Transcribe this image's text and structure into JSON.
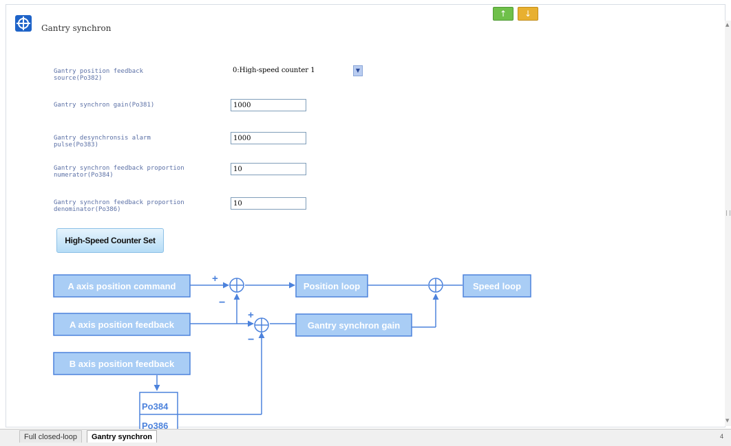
{
  "window": {
    "title": "Gantry synchron"
  },
  "toolbar": {
    "upload_label": "↑",
    "download_label": "↓"
  },
  "params": {
    "feedback_source": {
      "label": "Gantry position feedback source(Po382)",
      "value": "0:High-speed counter 1"
    },
    "synchron_gain": {
      "label": "Gantry synchron gain(Po381)",
      "value": "1000"
    },
    "alarm_pulse": {
      "label": "Gantry desynchronsis alarm pulse(Po383)",
      "value": "1000"
    },
    "numerator": {
      "label": "Gantry synchron feedback proportion numerator(Po384)",
      "value": "10"
    },
    "denominator": {
      "label": "Gantry synchron feedback proportion denominator(Po386)",
      "value": "10"
    }
  },
  "hsc_button_label": "High-Speed Counter Set",
  "diagram": {
    "a_cmd": "A axis position command",
    "a_fb": "A axis position feedback",
    "b_fb": "B axis position feedback",
    "pos_loop": "Position loop",
    "speed_loop": "Speed loop",
    "gantry_gain": "Gantry synchron gain",
    "po384": "Po384",
    "po386": "Po386",
    "plus": "+",
    "minus": "−"
  },
  "tabs": [
    {
      "label": "Full closed-loop",
      "active": false
    },
    {
      "label": "Gantry synchron",
      "active": true
    }
  ],
  "page_indicator": "4",
  "colors": {
    "accent_blue": "#4c82dc",
    "block_fill": "#a9cdf5",
    "label_text": "#5a6fa5"
  }
}
